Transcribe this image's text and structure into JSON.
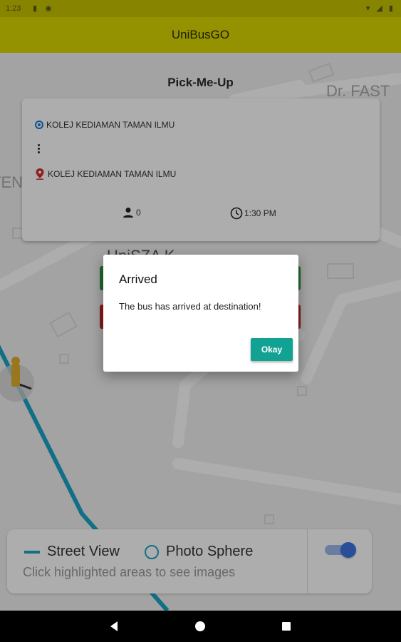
{
  "status_bar": {
    "time": "1:23"
  },
  "app_bar": {
    "title": "UniBusGO"
  },
  "map_labels": {
    "dr_fast": "Dr. FAST",
    "left_fragment": "TEN",
    "partial_label": "UniSZA K"
  },
  "page": {
    "title": "Pick-Me-Up"
  },
  "trip_card": {
    "origin": "KOLEJ KEDIAMAN TAMAN ILMU",
    "destination": "KOLEJ KEDIAMAN TAMAN ILMU",
    "passengers": "0",
    "time": "1:30 PM"
  },
  "dialog": {
    "title": "Arrived",
    "message": "The bus has arrived at destination!",
    "ok_label": "Okay"
  },
  "legend": {
    "street_view": "Street View",
    "photo_sphere": "Photo Sphere",
    "hint": "Click highlighted areas to see images",
    "toggle_on": true
  },
  "colors": {
    "app_bar": "#dbd800",
    "accent": "#12a294",
    "street_view_line": "#1aa6c4",
    "origin_icon": "#1976d2",
    "destination_icon": "#d32f2f"
  },
  "icons": [
    "origin-dot-icon",
    "more-vert-icon",
    "location-pin-icon",
    "person-icon",
    "clock-icon",
    "pegman-icon",
    "back-icon",
    "home-icon",
    "recents-icon"
  ]
}
